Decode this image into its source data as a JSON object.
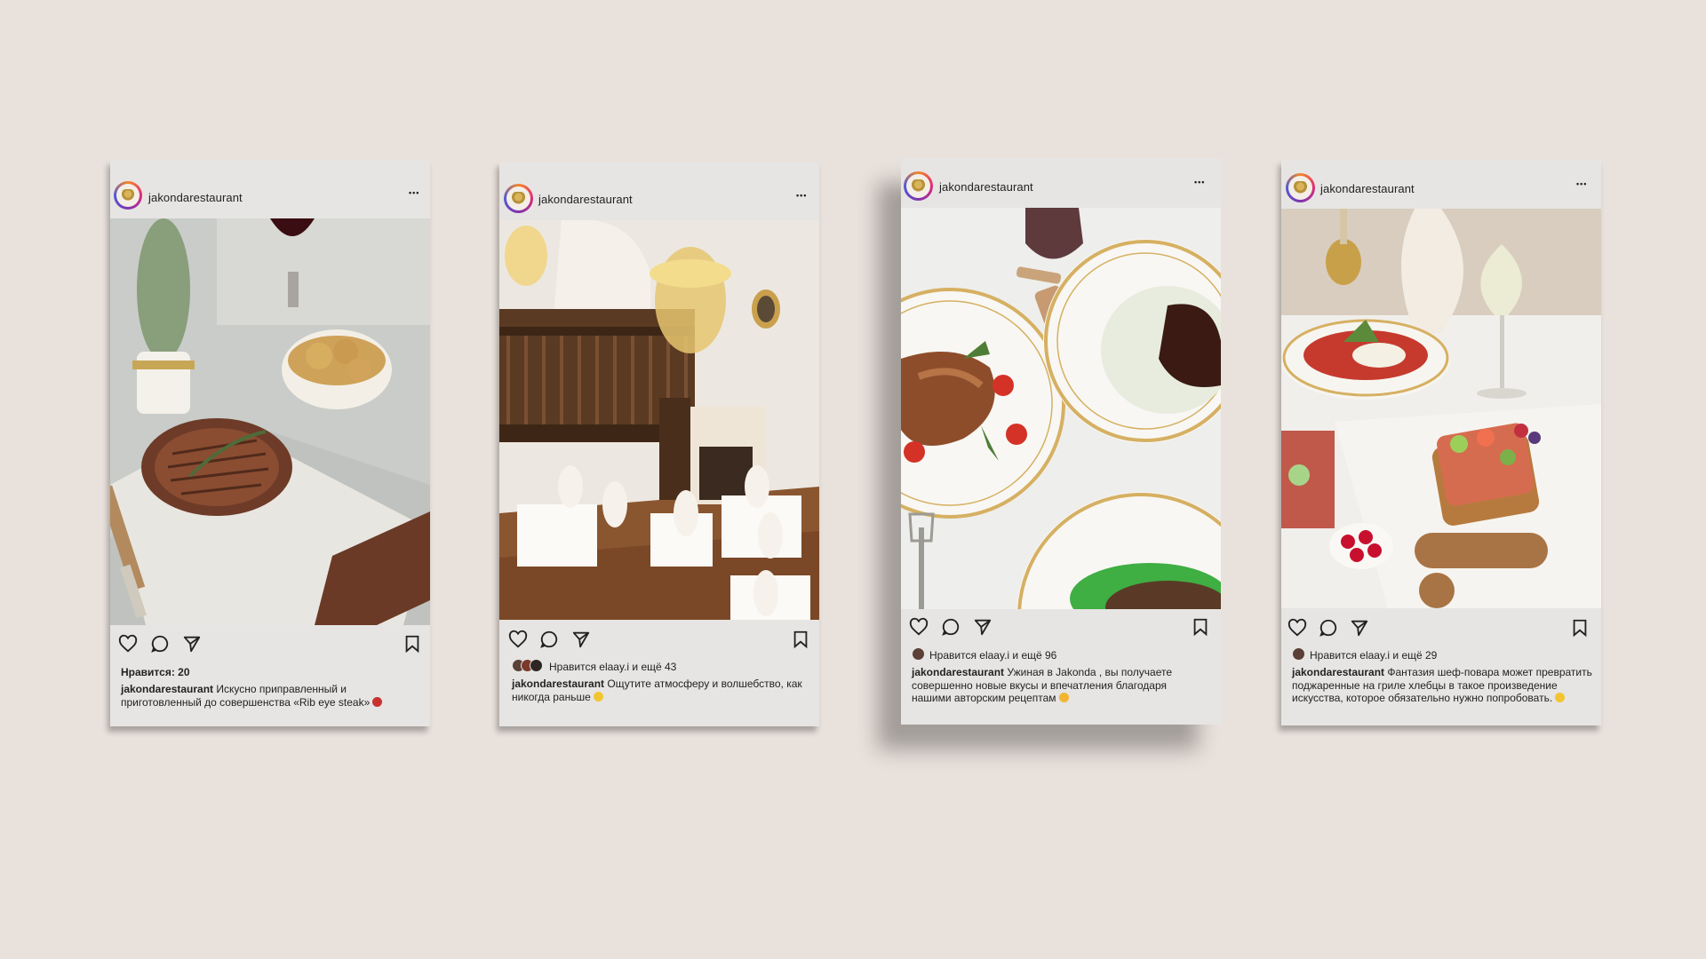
{
  "posts": [
    {
      "username": "jakondarestaurant",
      "more_label": "•••",
      "likes_text": "Нравится: 20",
      "caption_user": "jakondarestaurant",
      "caption_text": " Искусно приправленный и приготовленный до совершенства «Rib eye steak»",
      "icons": [
        "heart-icon",
        "comment-icon",
        "share-icon",
        "bookmark-icon"
      ]
    },
    {
      "username": "jakondarestaurant",
      "more_label": "•••",
      "likes_text": "Нравится elaay.i и ещё 43",
      "caption_user": "jakondarestaurant",
      "caption_text": " Ощутите атмосферу и волшебство, как никогда раньше",
      "icons": [
        "heart-icon",
        "comment-icon",
        "share-icon",
        "bookmark-icon"
      ]
    },
    {
      "username": "jakondarestaurant",
      "more_label": "•••",
      "likes_text": "Нравится elaay.i и ещё 96",
      "caption_user": "jakondarestaurant",
      "caption_text": " Ужиная  в Jakonda , вы получаете совершенно новые вкусы и впечатления благодаря нашими авторским рецептам",
      "icons": [
        "heart-icon",
        "comment-icon",
        "share-icon",
        "bookmark-icon"
      ]
    },
    {
      "username": "jakondarestaurant",
      "more_label": "•••",
      "likes_text": "Нравится elaay.i и ещё 29",
      "caption_user": "jakondarestaurant",
      "caption_text": " Фантазия шеф-повара может превратить поджаренные на гриле хлебцы в такое произведение искусства, которое обязательно нужно попробовать.",
      "icons": [
        "heart-icon",
        "comment-icon",
        "share-icon",
        "bookmark-icon"
      ]
    }
  ],
  "colors": {
    "background": "#e9e1db",
    "card": "#e6e5e3",
    "text": "#222222"
  }
}
